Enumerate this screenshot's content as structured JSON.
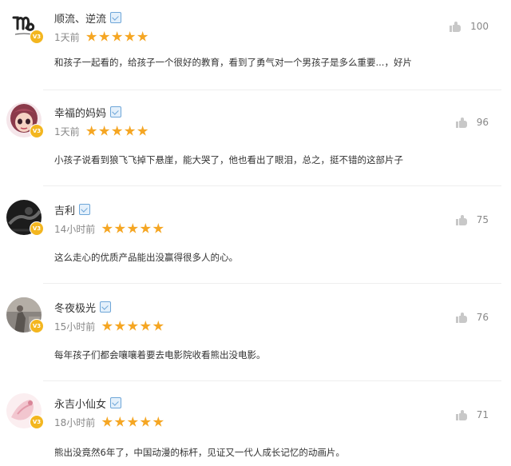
{
  "comments": [
    {
      "username": "顺流、逆流",
      "time": "1天前",
      "likes": "100",
      "text": "和孩子一起看的，给孩子一个很好的教育，看到了勇气对一个男孩子是多么重要...，好片",
      "rating": 5,
      "vip_badge": "V3",
      "avatar": "capricorn-logo"
    },
    {
      "username": "幸福的妈妈",
      "time": "1天前",
      "likes": "96",
      "text": "小孩子说看到狼飞飞掉下悬崖，能大哭了，他也看出了眼泪，总之，挺不错的这部片子",
      "rating": 5,
      "vip_badge": "V3",
      "avatar": "cartoon-girl"
    },
    {
      "username": "吉利",
      "time": "14小时前",
      "likes": "75",
      "text": "这么走心的优质产品能出没赢得很多人的心。",
      "rating": 5,
      "vip_badge": "V3",
      "avatar": "dark-photo"
    },
    {
      "username": "冬夜极光",
      "time": "15小时前",
      "likes": "76",
      "text": "每年孩子们都会嚷嚷着要去电影院收看熊出没电影。",
      "rating": 5,
      "vip_badge": "V3",
      "avatar": "grey-photo"
    },
    {
      "username": "永吉小仙女",
      "time": "18小时前",
      "likes": "71",
      "text": "熊出没竟然6年了，中国动漫的标杆，见证又一代人成长记忆的动画片。",
      "rating": 5,
      "vip_badge": "V3",
      "avatar": "pink-flower"
    }
  ],
  "colors": {
    "star": "#f5a623",
    "vip_badge": "#f3b61f",
    "level_icon": "#6ea6d8",
    "muted_text": "#888888",
    "divider": "#eeeeee"
  },
  "icons": {
    "like": "thumbs-up-icon",
    "level": "level-badge-icon",
    "star": "star-icon"
  }
}
